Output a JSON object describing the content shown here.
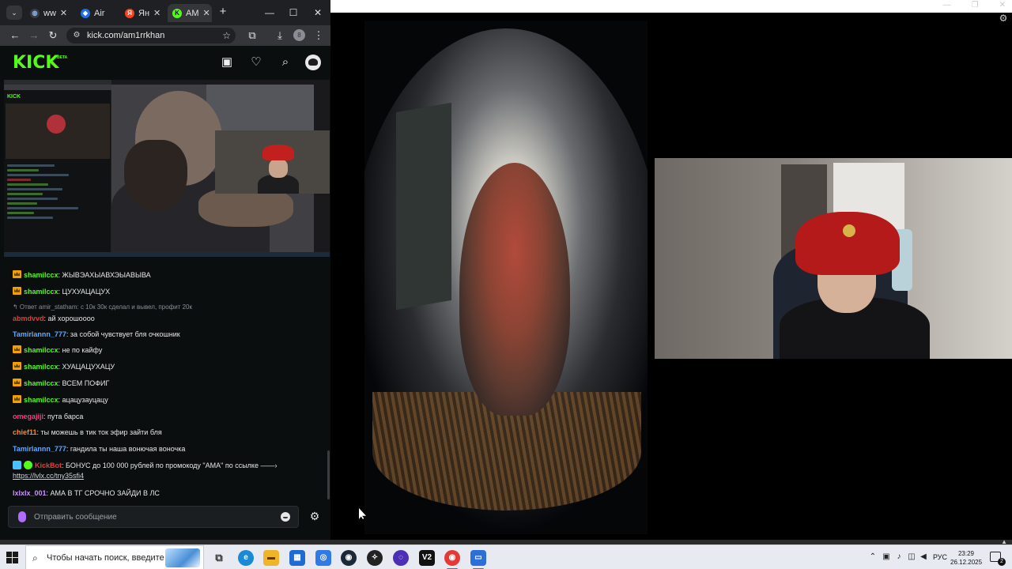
{
  "browser": {
    "tabs": [
      {
        "label": "ww",
        "favicon": "globe-icon",
        "color": "#8ab4f8"
      },
      {
        "label": "Air",
        "favicon": "airtable-icon",
        "color": "#1f6feb"
      },
      {
        "label": "Ян",
        "favicon": "yandex-icon",
        "color": "#fc3f1d"
      },
      {
        "label": "AM",
        "favicon": "kick-icon",
        "color": "#53fc18"
      }
    ],
    "url": "kick.com/am1rrkhan",
    "profile_initial": "8"
  },
  "kick": {
    "logo": "KICK",
    "logo_sup": "BETA",
    "accent": "#53fc18"
  },
  "chat": {
    "messages": [
      {
        "user": "shamilccx",
        "user_color": "#53fc18",
        "badge": "sub",
        "text": ": ЖЫВЭАХЫАВХЭЫАВЫВА"
      },
      {
        "user": "shamilccx",
        "user_color": "#53fc18",
        "badge": "sub",
        "text": ": ЦУХУАЦАЦУХ"
      },
      {
        "reply": "↰ Ответ amir_statham: с 10к 30к сделал и вывел, профит 20к",
        "user": "abmdvvd",
        "user_color": "#e63a3a",
        "text": ": ай хорошоооо"
      },
      {
        "user": "Tamirlannn_777",
        "user_color": "#5fa8ff",
        "text": ": за собой чувствует бля очкошник"
      },
      {
        "user": "shamilccx",
        "user_color": "#53fc18",
        "badge": "sub",
        "text": ": не по кайфу"
      },
      {
        "user": "shamilccx",
        "user_color": "#53fc18",
        "badge": "sub",
        "text": ": ХУАЦАЦУХАЦУ"
      },
      {
        "user": "shamilccx",
        "user_color": "#53fc18",
        "badge": "sub",
        "text": ": ВСЕМ ПОФИГ"
      },
      {
        "user": "shamilccx",
        "user_color": "#53fc18",
        "badge": "sub",
        "text": ": ацацузауцацу"
      },
      {
        "user": "omegajiji",
        "user_color": "#ff3b7a",
        "text": ": пута барса"
      },
      {
        "user": "chief11",
        "user_color": "#ff8a1e",
        "text": ": ты можешь в тик ток эфир зайти бля"
      },
      {
        "user": "Tamirlannn_777",
        "user_color": "#5fa8ff",
        "text": ": гандила ты наша вонючая воночка"
      },
      {
        "user": "KickBot",
        "user_color": "#e63a3a",
        "badge": "bot",
        "text": ": БОНУС до 100 000 рублей по промокоду \"АМА\" по ссылке ——›",
        "link": "https://lvlx.cc/tny35sfi4"
      },
      {
        "user": "lxlxlx_001",
        "user_color": "#c891ff",
        "text": ": АМА В ТГ СРОЧНО ЗАЙДИ В ЛС"
      }
    ],
    "input_placeholder": "Отправить сообщение"
  },
  "taskbar": {
    "search_placeholder": "Чтобы начать поиск, введите",
    "apps": [
      {
        "name": "task-view-icon",
        "color": "#3d3d3d"
      },
      {
        "name": "edge-icon",
        "color": "#1b8ad6"
      },
      {
        "name": "file-explorer-icon",
        "color": "#f0b429"
      },
      {
        "name": "store-icon",
        "color": "#1e6cd1"
      },
      {
        "name": "app-icon",
        "color": "#2f7ae5"
      },
      {
        "name": "steam-icon",
        "color": "#1b2838"
      },
      {
        "name": "app-icon-2",
        "color": "#222222"
      },
      {
        "name": "app-icon-3",
        "color": "#4b2fb5"
      },
      {
        "name": "v2-icon",
        "color": "#111111",
        "label": "V2"
      },
      {
        "name": "chrome-icon",
        "color": "#e53935"
      },
      {
        "name": "remote-desktop-icon",
        "color": "#2d6fd8"
      }
    ],
    "lang": "РУС",
    "time": "23:29",
    "date": "26.12.2025",
    "notification_count": "2"
  }
}
